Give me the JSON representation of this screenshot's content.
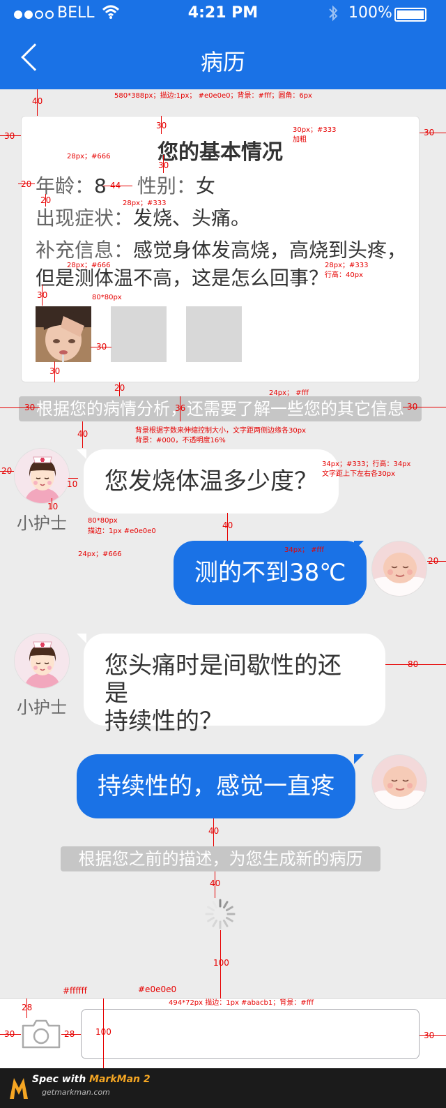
{
  "status": {
    "carrier": "BELL",
    "time": "4:21 PM",
    "battery": "100%"
  },
  "nav": {
    "title": "病历"
  },
  "card": {
    "title": "您的基本情况",
    "age_label": "年龄：",
    "age_value": "8",
    "gender_label": "性别：",
    "gender_value": "女",
    "symptom_label": "出现症状：",
    "symptom_value": "发烧、头痛。",
    "extra_label": "补充信息：",
    "extra_value_line1": "感觉身体发高烧，高烧到头疼，",
    "extra_value_line2": "但是测体温不高，这是怎么回事？"
  },
  "notice1": "根据您的病情分析，还需要了解一些您的其它信息",
  "chat": [
    {
      "side": "in",
      "name": "小护士",
      "text": "您发烧体温多少度？"
    },
    {
      "side": "out",
      "text": "测的不到38℃"
    },
    {
      "side": "in",
      "name": "小护士",
      "text_line1": "您头痛时是间歇性的还是",
      "text_line2": "持续性的？"
    },
    {
      "side": "out",
      "text": "持续性的，感觉一直疼"
    }
  ],
  "notice2": "根据您之前的描述，为您生成新的病历",
  "input": {
    "value": ""
  },
  "watermark": {
    "line1_prefix": "Spec with ",
    "line1_brand": "MarkMan 2",
    "line2": "getmarkman.com"
  },
  "colors": {
    "primary": "#1a72e6",
    "bubble_in": "#ffffff",
    "background": "#ececec",
    "annotation": "#e60000"
  },
  "annotations": {
    "a_40_top": "40",
    "a_card_spec": "580*388px；描边:1px； #e0e0e0；背景：#fff；圆角：6px",
    "a_30_left": "30",
    "a_30_right": "30",
    "a_30_title": "30",
    "a_title_font": "30px；#333",
    "a_title_bold": "加粗",
    "a_28_666": "28px；#666",
    "a_30_b": "30",
    "a_20_left": "20",
    "a_44": "44",
    "a_20_b": "20",
    "a_28_333": "28px；#333",
    "a_28_666_b": "28px；#666",
    "a_28_333_b": "28px；#333",
    "a_lh40": "行高：40px",
    "a_30_c": "30",
    "a_80x80": "80*80px",
    "a_30_d": "30",
    "a_30_e": "30",
    "a_20_c": "20",
    "a_24_fff": "24px； #fff",
    "a_30_f": "30",
    "a_36": "36",
    "a_30_g": "30",
    "a_bg_rule": "背景根据字数来伸缩控制大小，文字距两侧边缘各30px",
    "a_bg_color": "背景：#000，不透明度16%",
    "a_40_b": "40",
    "a_20_d": "20",
    "a_10": "10",
    "a_10_b": "10",
    "a_34_333": "34px；#333；行高：34px",
    "a_pad30": "文字距上下左右各30px",
    "a_80x80_b": "80*80px",
    "a_border": "描边：1px #e0e0e0",
    "a_24_666": "24px；#666",
    "a_40_c": "40",
    "a_34_fff": "34px； #fff",
    "a_20_e": "20",
    "a_80": "80",
    "a_40_d": "40",
    "a_40_e": "40",
    "a_100": "100",
    "a_ffffff": "#ffffff",
    "a_e0e0e0": "#e0e0e0",
    "a_28": "28",
    "a_input_spec": "494*72px 描边：1px #abacb1；背景：#fff",
    "a_30_h": "30",
    "a_28_b": "28",
    "a_100_b": "100",
    "a_30_i": "30"
  }
}
